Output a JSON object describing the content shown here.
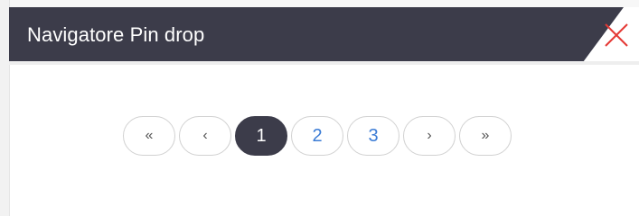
{
  "window": {
    "title": "Navigatore Pin drop",
    "close_icon": "close-icon",
    "accent_color": "#3c3c4a",
    "close_color": "#e53935"
  },
  "pagination": {
    "first_label": "«",
    "prev_label": "‹",
    "pages": [
      "1",
      "2",
      "3"
    ],
    "active_page": "1",
    "next_label": "›",
    "last_label": "»",
    "link_color": "#3a7bd5"
  }
}
